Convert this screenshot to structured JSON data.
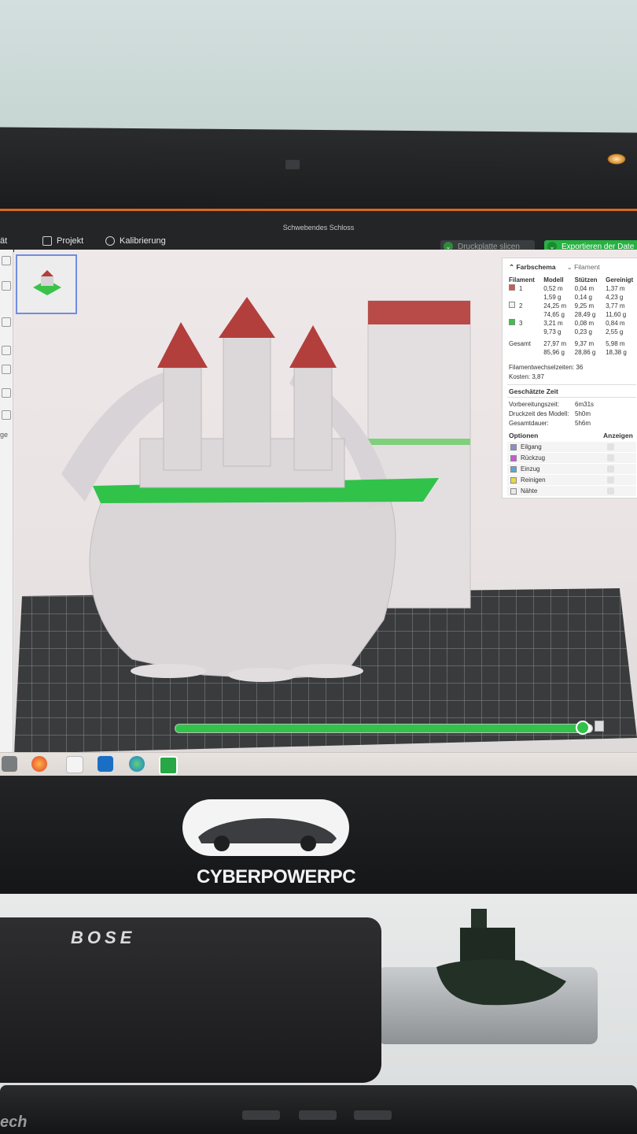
{
  "window": {
    "title": "Schwebendes Schloss",
    "left_cut_label": "ät"
  },
  "menu": {
    "projekt": "Projekt",
    "kalibrierung": "Kalibrierung"
  },
  "actions": {
    "slice_label": "Druckplatte slicen",
    "export_label": "Exportieren der Date"
  },
  "left_tools": {
    "label": "ge"
  },
  "panel": {
    "farbschema": "Farbschema",
    "filament_mode": "Filament",
    "columns": [
      "Filament",
      "Modell",
      "Stützen",
      "Gereinigt"
    ],
    "rows": [
      {
        "id": "1",
        "color": "#d9534f",
        "modell": [
          "0,52 m",
          "1,59 g"
        ],
        "stuetzen": [
          "0,04 m",
          "0,14 g"
        ],
        "gereinigt": [
          "1,37 m",
          "4,23 g"
        ]
      },
      {
        "id": "2",
        "color": "#f2f2f2",
        "modell": [
          "24,25 m",
          "74,65 g"
        ],
        "stuetzen": [
          "9,25 m",
          "28,49 g"
        ],
        "gereinigt": [
          "3,77 m",
          "11,60 g"
        ]
      },
      {
        "id": "3",
        "color": "#3cc24a",
        "modell": [
          "3,21 m",
          "9,73 g"
        ],
        "stuetzen": [
          "0,08 m",
          "0,23 g"
        ],
        "gereinigt": [
          "0,84 m",
          "2,55 g"
        ]
      }
    ],
    "total": {
      "label": "Gesamt",
      "modell": [
        "27,97 m",
        "85,96 g"
      ],
      "stuetzen": [
        "9,37 m",
        "28,86 g"
      ],
      "gereinigt": [
        "5,98 m",
        "18,38 g"
      ]
    },
    "filamentwechsel": "Filamentwechselzeiten:  36",
    "kosten": "Kosten:  3,87",
    "geschaetzte_zeit": "Geschätzte Zeit",
    "times": [
      {
        "label": "Vorbereitungszeit:",
        "value": "6m31s"
      },
      {
        "label": "Druckzeit des Modell:",
        "value": "5h0m"
      },
      {
        "label": "Gesamtdauer:",
        "value": "5h6m"
      }
    ],
    "optionen": "Optionen",
    "anzeigen": "Anzeigen",
    "options": [
      {
        "label": "Eilgang",
        "color": "#8a8fc9"
      },
      {
        "label": "Rückzug",
        "color": "#c95ad1"
      },
      {
        "label": "Einzug",
        "color": "#5aa6d6"
      },
      {
        "label": "Reinigen",
        "color": "#e6d84a"
      },
      {
        "label": "Nähte",
        "color": "#e9e9e9"
      }
    ]
  },
  "slider": {
    "progress": 0.97
  },
  "bezel": {
    "brand": "CYBERPOWERPC"
  },
  "desk": {
    "speaker_brand": "BOSE",
    "keyboard_brand": "ech"
  }
}
